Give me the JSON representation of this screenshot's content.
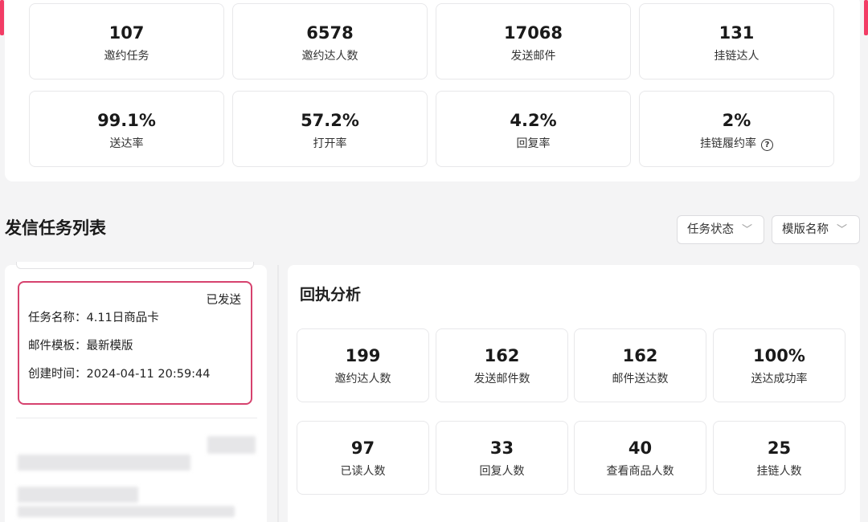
{
  "overview": {
    "stats": [
      {
        "value": "107",
        "label": "邀约任务"
      },
      {
        "value": "6578",
        "label": "邀约达人数"
      },
      {
        "value": "17068",
        "label": "发送邮件"
      },
      {
        "value": "131",
        "label": "挂链达人"
      }
    ],
    "rates": [
      {
        "value": "99.1%",
        "label": "送达率"
      },
      {
        "value": "57.2%",
        "label": "打开率"
      },
      {
        "value": "4.2%",
        "label": "回复率"
      },
      {
        "value": "2%",
        "label": "挂链履约率",
        "help_icon": "question-circle-icon"
      }
    ]
  },
  "task_list": {
    "title": "发信任务列表",
    "filters": [
      {
        "label": "任务状态",
        "icon": "chevron-down-icon"
      },
      {
        "label": "模版名称",
        "icon": "chevron-down-icon"
      }
    ],
    "selected_task": {
      "status": "已发送",
      "name_label": "任务名称：",
      "name": "4.11日商品卡",
      "template_label": "邮件模板：",
      "template": "最新模版",
      "created_label": "创建时间：",
      "created": "2024-04-11 20:59:44"
    }
  },
  "receipt_analysis": {
    "title": "回执分析",
    "metrics": [
      {
        "value": "199",
        "label": "邀约达人数"
      },
      {
        "value": "162",
        "label": "发送邮件数"
      },
      {
        "value": "162",
        "label": "邮件送达数"
      },
      {
        "value": "100%",
        "label": "送达成功率"
      },
      {
        "value": "97",
        "label": "已读人数"
      },
      {
        "value": "33",
        "label": "回复人数"
      },
      {
        "value": "40",
        "label": "查看商品人数"
      },
      {
        "value": "25",
        "label": "挂链人数"
      }
    ]
  },
  "colors": {
    "accent": "#f23c65",
    "selected_border": "#d6426e"
  }
}
